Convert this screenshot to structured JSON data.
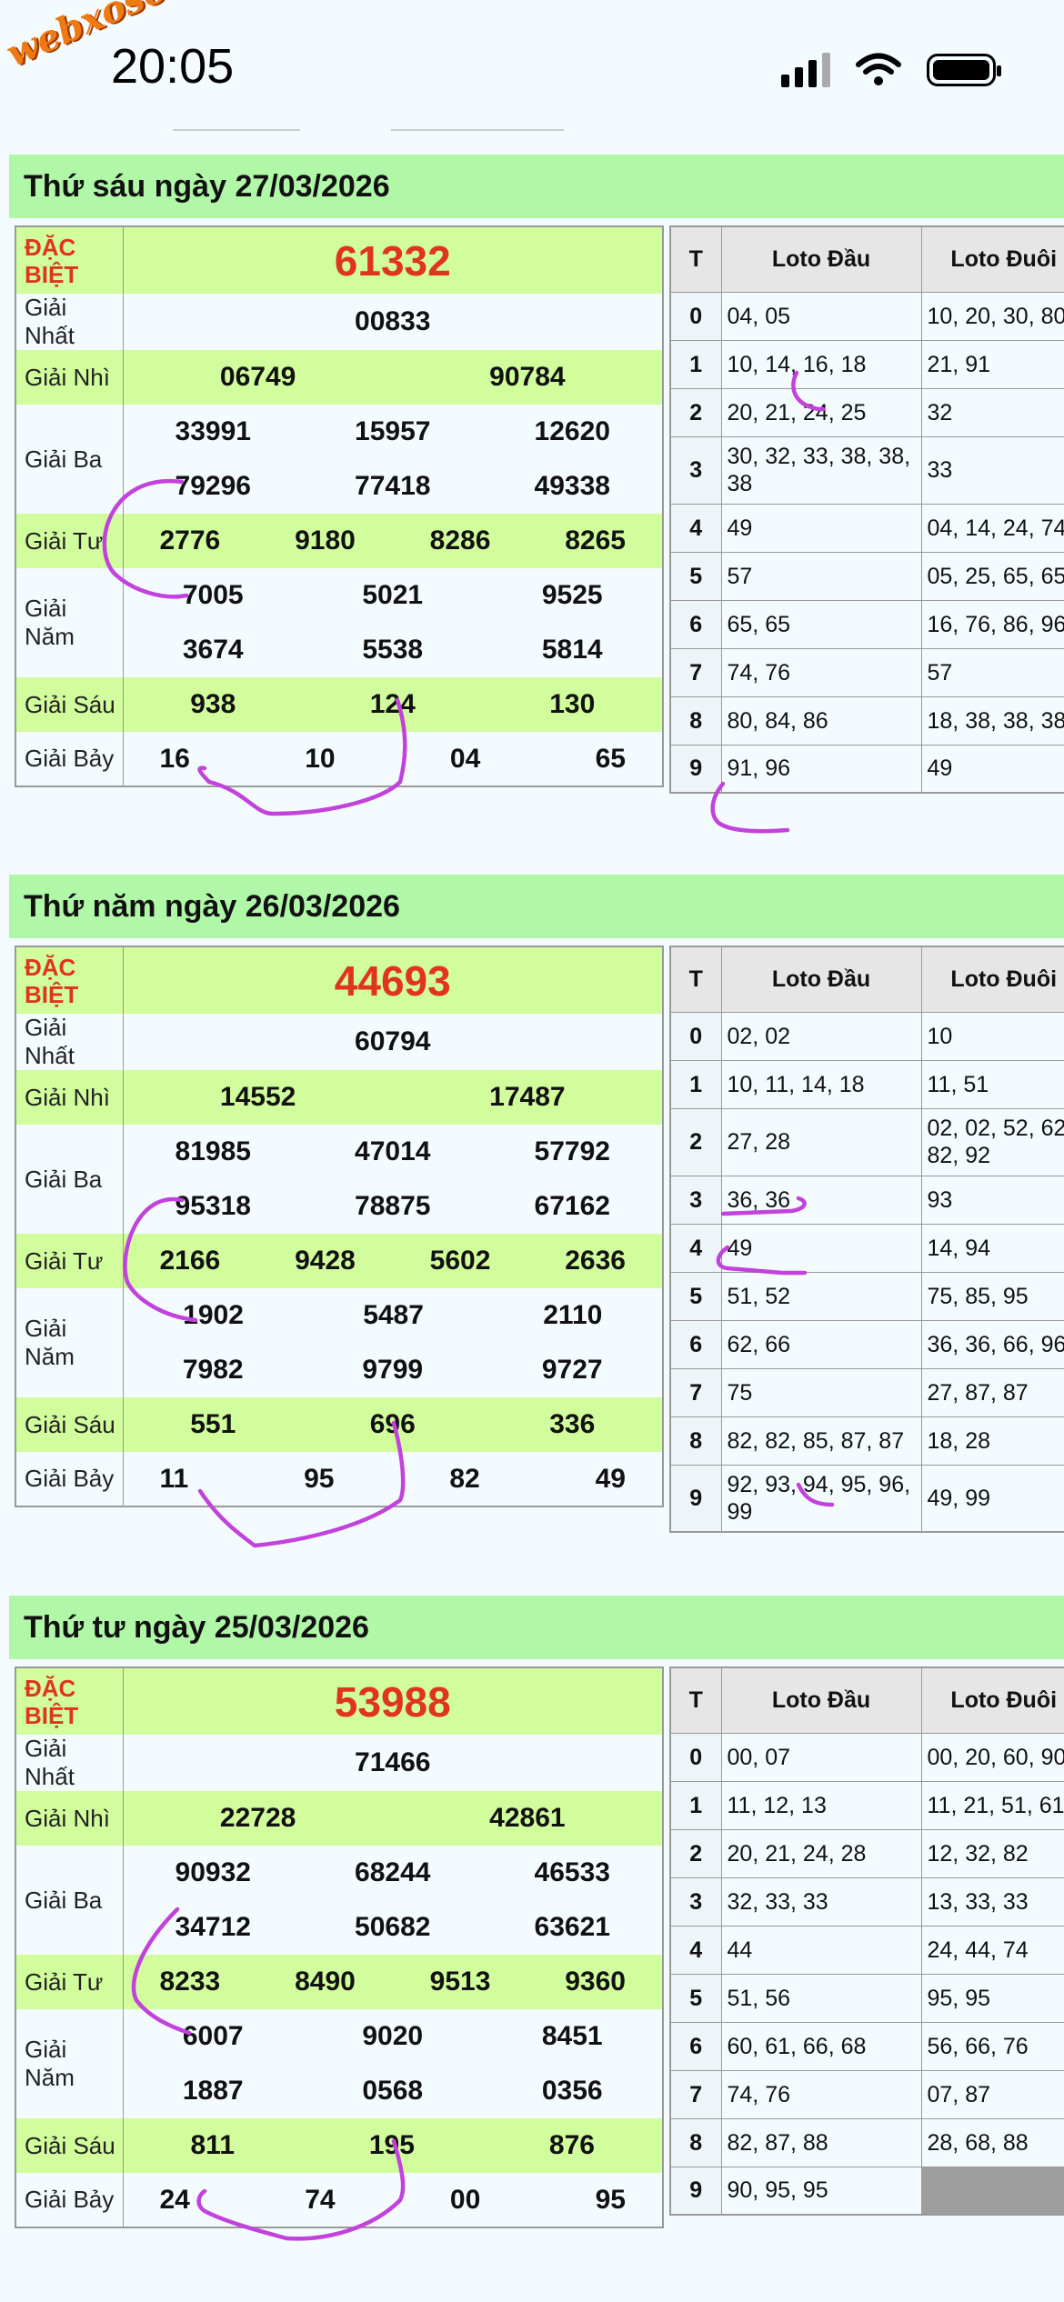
{
  "status": {
    "watermark": "webxoso.net",
    "time": "20:05",
    "icons": [
      "signal-icon",
      "wifi-icon",
      "battery-icon"
    ]
  },
  "days": [
    {
      "title": "Thứ sáu ngày 27/03/2026",
      "prizes": {
        "db_label": "ĐẶC BIỆT",
        "db": "61332",
        "nhat_label": "Giải Nhất",
        "nhat": [
          "00833"
        ],
        "nhi_label": "Giải Nhì",
        "nhi": [
          "06749",
          "90784"
        ],
        "ba_label": "Giải Ba",
        "ba": [
          "33991",
          "15957",
          "12620",
          "79296",
          "77418",
          "49338"
        ],
        "tu_label": "Giải Tư",
        "tu": [
          "2776",
          "9180",
          "8286",
          "8265"
        ],
        "nam_label": "Giải Năm",
        "nam": [
          "7005",
          "5021",
          "9525",
          "3674",
          "5538",
          "5814"
        ],
        "sau_label": "Giải Sáu",
        "sau": [
          "938",
          "124",
          "130"
        ],
        "bay_label": "Giải Bảy",
        "bay": [
          "16",
          "10",
          "04",
          "65"
        ]
      },
      "loto": {
        "headers": [
          "T",
          "Loto Đầu",
          "Loto Đuôi"
        ],
        "rows": [
          [
            "0",
            "04, 05",
            "10, 20, 30, 80"
          ],
          [
            "1",
            "10, 14, 16, 18",
            "21, 91"
          ],
          [
            "2",
            "20, 21, 24, 25",
            "32"
          ],
          [
            "3",
            "30, 32, 33, 38, 38, 38",
            "33"
          ],
          [
            "4",
            "49",
            "04, 14, 24, 74,"
          ],
          [
            "5",
            "57",
            "05, 25, 65, 65"
          ],
          [
            "6",
            "65, 65",
            "16, 76, 86, 96"
          ],
          [
            "7",
            "74, 76",
            "57"
          ],
          [
            "8",
            "80, 84, 86",
            "18, 38, 38, 38"
          ],
          [
            "9",
            "91, 96",
            "49"
          ]
        ]
      }
    },
    {
      "title": "Thứ năm ngày 26/03/2026",
      "prizes": {
        "db_label": "ĐẶC BIỆT",
        "db": "44693",
        "nhat_label": "Giải Nhất",
        "nhat": [
          "60794"
        ],
        "nhi_label": "Giải Nhì",
        "nhi": [
          "14552",
          "17487"
        ],
        "ba_label": "Giải Ba",
        "ba": [
          "81985",
          "47014",
          "57792",
          "95318",
          "78875",
          "67162"
        ],
        "tu_label": "Giải Tư",
        "tu": [
          "2166",
          "9428",
          "5602",
          "2636"
        ],
        "nam_label": "Giải Năm",
        "nam": [
          "1902",
          "5487",
          "2110",
          "7982",
          "9799",
          "9727"
        ],
        "sau_label": "Giải Sáu",
        "sau": [
          "551",
          "696",
          "336"
        ],
        "bay_label": "Giải Bảy",
        "bay": [
          "11",
          "95",
          "82",
          "49"
        ]
      },
      "loto": {
        "headers": [
          "T",
          "Loto Đầu",
          "Loto Đuôi"
        ],
        "rows": [
          [
            "0",
            "02, 02",
            "10"
          ],
          [
            "1",
            "10, 11, 14, 18",
            "11, 51"
          ],
          [
            "2",
            "27, 28",
            "02, 02, 52, 62, 82, 92"
          ],
          [
            "3",
            "36, 36",
            "93"
          ],
          [
            "4",
            "49",
            "14, 94"
          ],
          [
            "5",
            "51, 52",
            "75, 85, 95"
          ],
          [
            "6",
            "62, 66",
            "36, 36, 66, 96"
          ],
          [
            "7",
            "75",
            "27, 87, 87"
          ],
          [
            "8",
            "82, 82, 85, 87, 87",
            "18, 28"
          ],
          [
            "9",
            "92, 93, 94, 95, 96, 99",
            "49, 99"
          ]
        ]
      }
    },
    {
      "title": "Thứ tư ngày 25/03/2026",
      "prizes": {
        "db_label": "ĐẶC BIỆT",
        "db": "53988",
        "nhat_label": "Giải Nhất",
        "nhat": [
          "71466"
        ],
        "nhi_label": "Giải Nhì",
        "nhi": [
          "22728",
          "42861"
        ],
        "ba_label": "Giải Ba",
        "ba": [
          "90932",
          "68244",
          "46533",
          "34712",
          "50682",
          "63621"
        ],
        "tu_label": "Giải Tư",
        "tu": [
          "8233",
          "8490",
          "9513",
          "9360"
        ],
        "nam_label": "Giải Năm",
        "nam": [
          "6007",
          "9020",
          "8451",
          "1887",
          "0568",
          "0356"
        ],
        "sau_label": "Giải Sáu",
        "sau": [
          "811",
          "195",
          "876"
        ],
        "bay_label": "Giải Bảy",
        "bay": [
          "24",
          "74",
          "00",
          "95"
        ]
      },
      "loto": {
        "headers": [
          "T",
          "Loto Đầu",
          "Loto Đuôi"
        ],
        "rows": [
          [
            "0",
            "00, 07",
            "00, 20, 60, 90"
          ],
          [
            "1",
            "11, 12, 13",
            "11, 21, 51, 61"
          ],
          [
            "2",
            "20, 21, 24, 28",
            "12, 32, 82"
          ],
          [
            "3",
            "32, 33, 33",
            "13, 33, 33"
          ],
          [
            "4",
            "44",
            "24, 44, 74"
          ],
          [
            "5",
            "51, 56",
            "95, 95"
          ],
          [
            "6",
            "60, 61, 66, 68",
            "56, 66, 76"
          ],
          [
            "7",
            "74, 76",
            "07, 87"
          ],
          [
            "8",
            "82, 87, 88",
            "28, 68, 88"
          ],
          [
            "9",
            "90, 95, 95",
            ""
          ]
        ]
      }
    }
  ]
}
